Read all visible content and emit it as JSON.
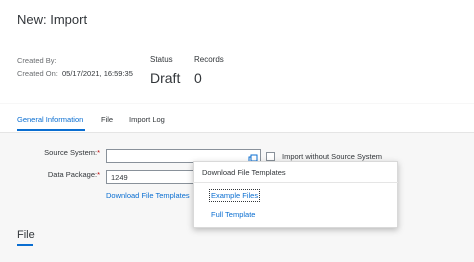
{
  "page": {
    "title": "New: Import"
  },
  "header": {
    "created_by_label": "Created By:",
    "created_by_value": "",
    "created_on_label": "Created On:",
    "created_on_value": "05/17/2021, 16:59:35",
    "status_label": "Status",
    "status_value": "Draft",
    "records_label": "Records",
    "records_value": "0"
  },
  "tabs": [
    {
      "label": "General Information",
      "selected": true
    },
    {
      "label": "File",
      "selected": false
    },
    {
      "label": "Import Log",
      "selected": false
    }
  ],
  "form": {
    "source_system_label": "Source System:",
    "source_system_value": "",
    "import_without_source_label": "Import without Source System",
    "import_without_source_checked": false,
    "data_package_label": "Data Package:",
    "data_package_value": "1249",
    "required_marker": "*",
    "download_templates_link": "Download File Templates"
  },
  "section": {
    "title": "File"
  },
  "popover": {
    "title": "Download File Templates",
    "items": [
      "Example Files",
      "Full Template"
    ]
  },
  "colors": {
    "accent": "#0a6ed1",
    "required": "#bb0000"
  },
  "icons": {
    "value_help": "value-help-icon"
  }
}
